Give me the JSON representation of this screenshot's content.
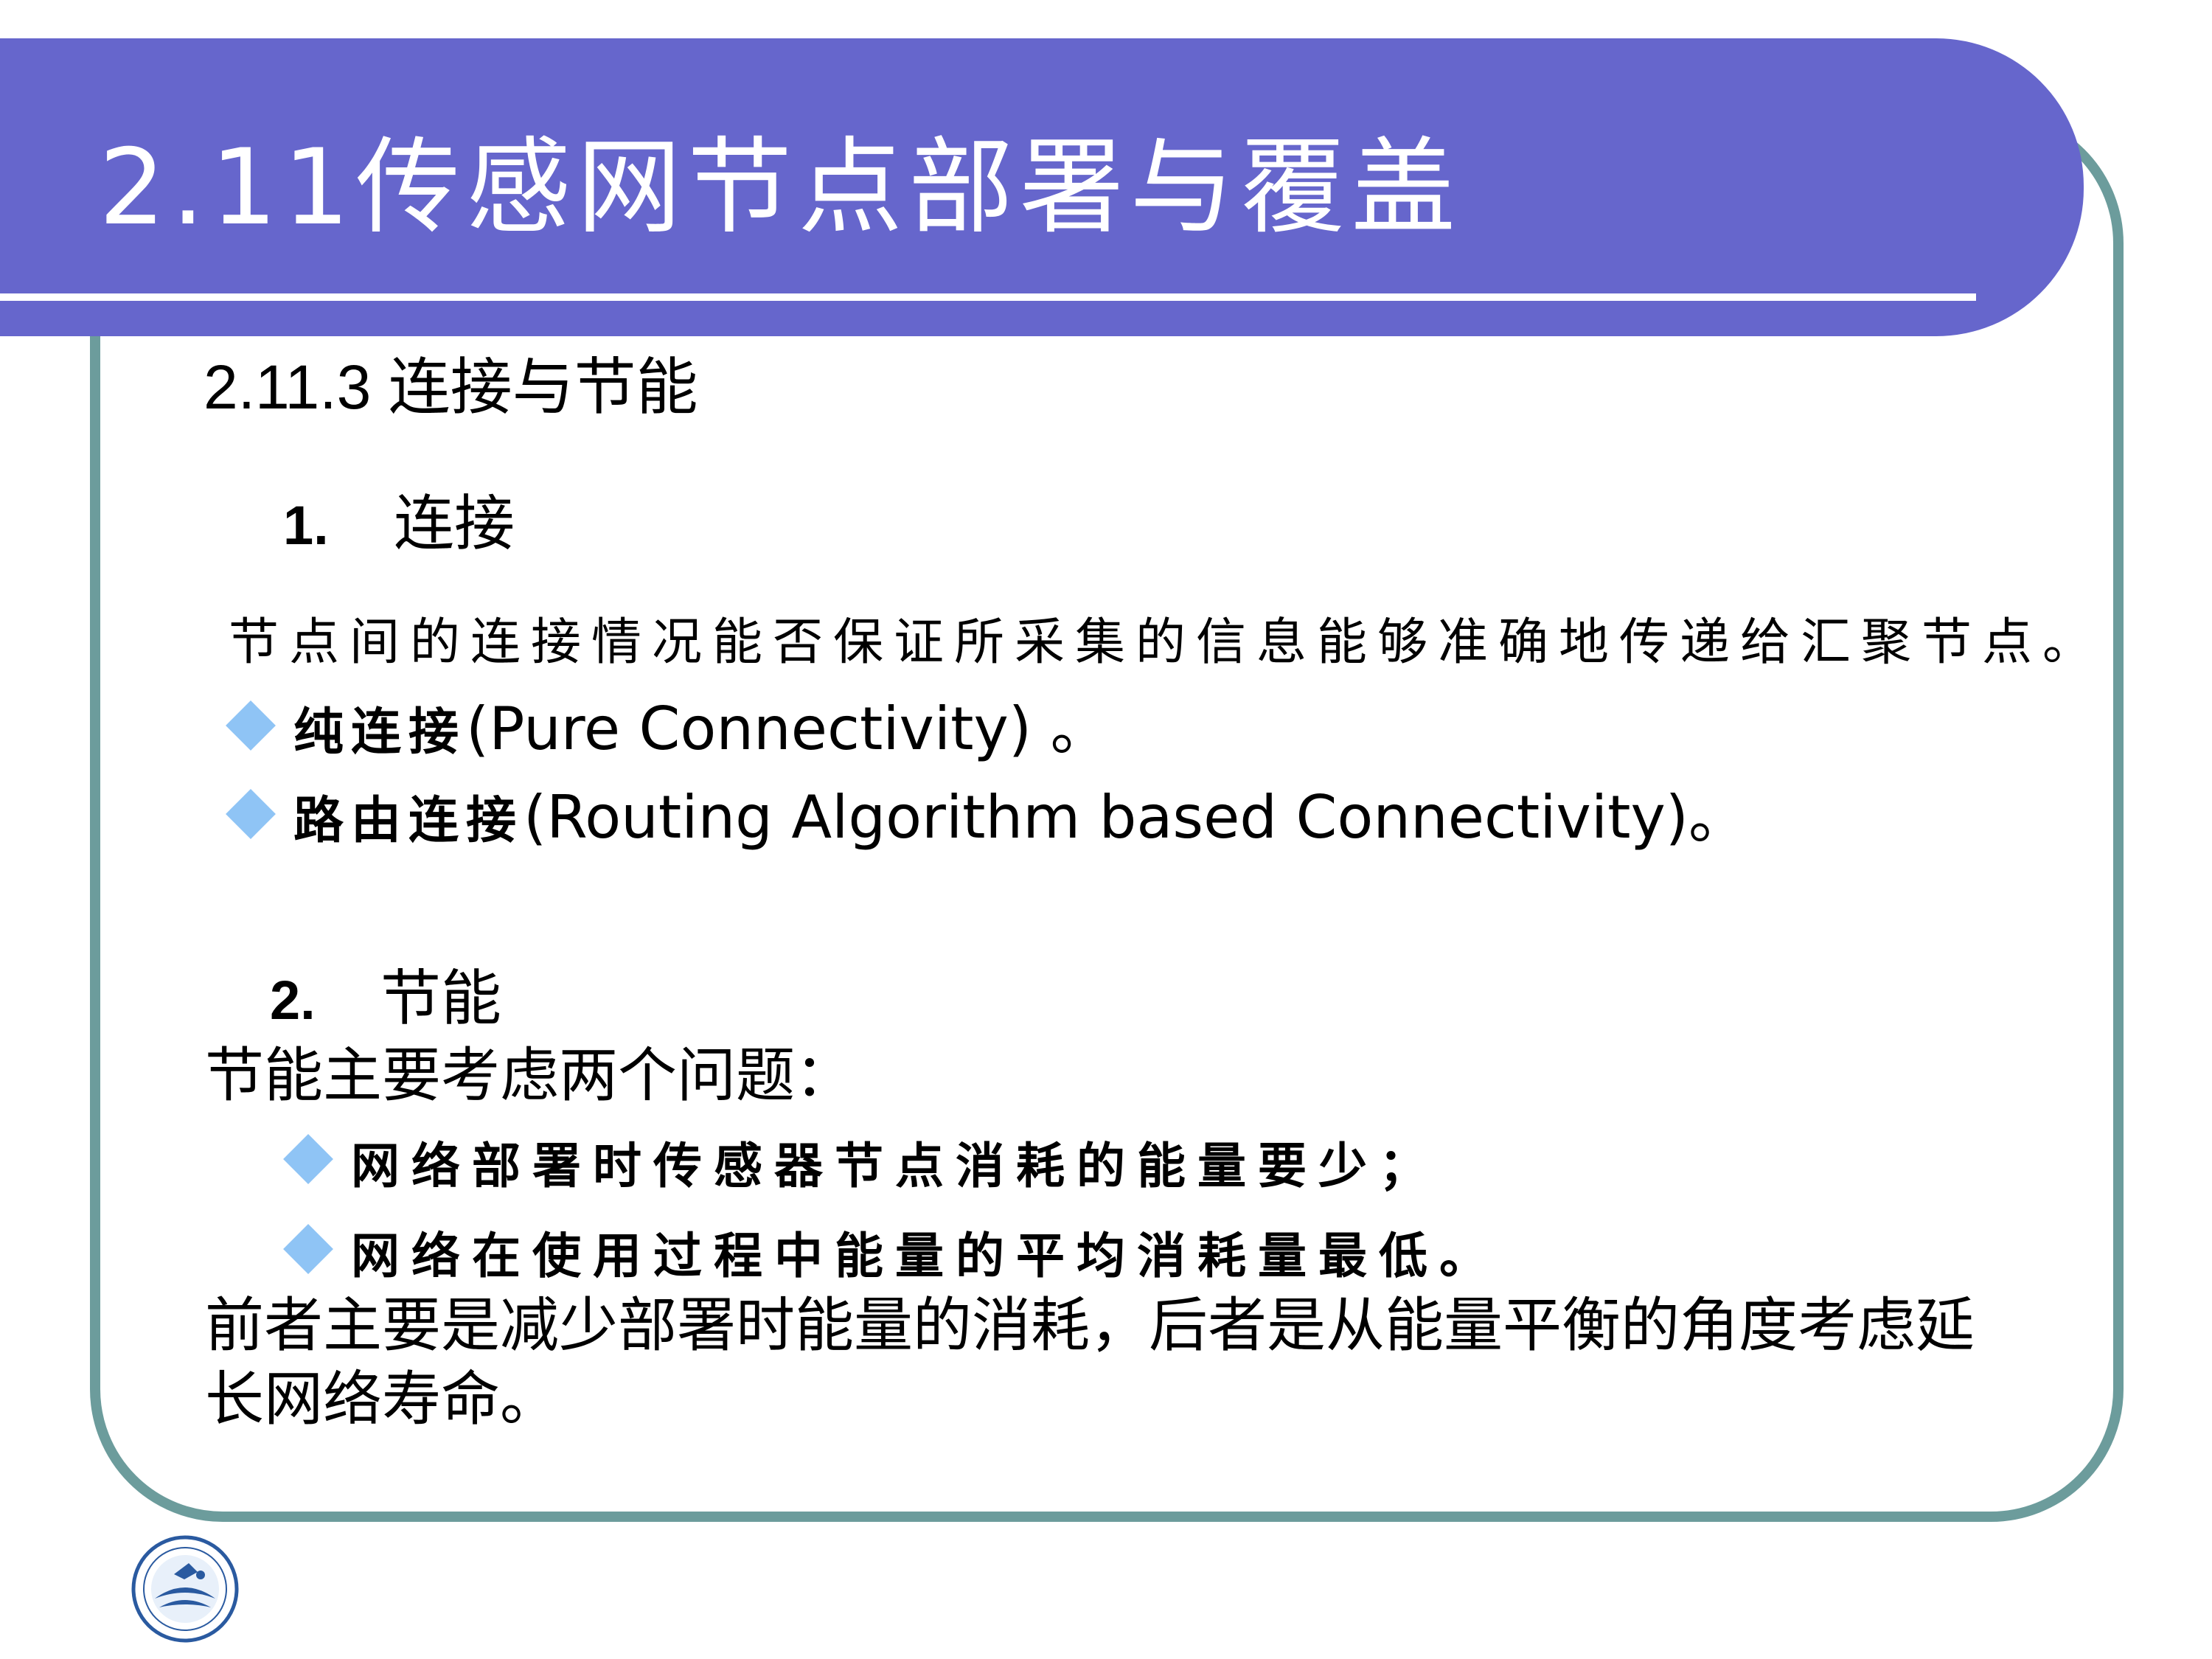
{
  "slide": {
    "title": "2.11传感网节点部署与覆盖",
    "subsection_title": "2.11.3 连接与节能"
  },
  "connectivity": {
    "number": "1.",
    "heading": "连接",
    "description": "节点间的连接情况能否保证所采集的信息能够准确地传递给汇聚节点。",
    "bullets": [
      {
        "cn": "纯连接",
        "en": "(Pure Connectivity) 。"
      },
      {
        "cn": "路由连接",
        "en": "(Routing Algorithm based Connectivity)。"
      }
    ]
  },
  "energy": {
    "number": "2.",
    "heading": "节能",
    "intro": "节能主要考虑两个问题：",
    "bullets": [
      "网络部署时传感器节点消耗的能量要少；",
      "网络在使用过程中能量的平均消耗量最低。"
    ],
    "summary_line1": "前者主要是减少部署时能量的消耗，后者是从能量平衡的角度考虑延",
    "summary_line2": "长网络寿命。"
  },
  "colors": {
    "banner": "#6666cc",
    "frame_border": "#6c9c9c",
    "bullet_diamond": "#8fc4f5",
    "title_text": "#ffffff"
  }
}
